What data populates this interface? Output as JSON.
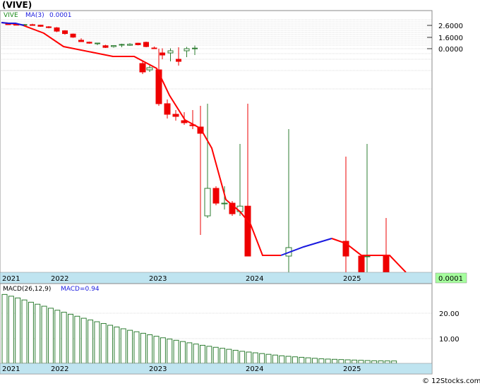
{
  "title": "(VIVE)",
  "watermark": "© 12Stocks.com",
  "colors": {
    "background": "#ffffff",
    "axis_bar": "#bfe4f0",
    "grid": "#bdbdbd",
    "candle_down": "#ee0000",
    "candle_up": "#2e7d32",
    "ma_down": "#ff0000",
    "ma_up": "#1a1adf",
    "macd_bar": "#2e7d32",
    "price_tag_bg": "#a5ff9d",
    "legend_symbol": "#1a8a1a",
    "legend_text": "#1a1adf"
  },
  "chart_data": [
    {
      "type": "candlestick",
      "panel": "price",
      "symbol": "VIVE",
      "legend": {
        "symbol": "VIVE",
        "ma_label": "MA(3)",
        "ma_value": "0.0001"
      },
      "y_ticks": [
        "2.6000",
        "1.6000",
        "0.0000"
      ],
      "last_price_label": "0.0001",
      "x_tick_labels": [
        "2021",
        "2022",
        "2023",
        "2024",
        "2025"
      ],
      "grid": true,
      "price_scale_note": "prices shown on an uneven (log-like) scale; estimated from candle positions",
      "candles": [
        {
          "date": "2021-01",
          "o": 2.72,
          "h": 2.78,
          "l": 2.66,
          "c": 2.68
        },
        {
          "date": "2021-02",
          "o": 2.68,
          "h": 2.74,
          "l": 2.6,
          "c": 2.64
        },
        {
          "date": "2021-03",
          "o": 2.63,
          "h": 2.7,
          "l": 2.58,
          "c": 2.67
        },
        {
          "date": "2021-04",
          "o": 2.66,
          "h": 2.74,
          "l": 2.58,
          "c": 2.62
        },
        {
          "date": "2021-05",
          "o": 2.62,
          "h": 2.66,
          "l": 2.48,
          "c": 2.52
        },
        {
          "date": "2021-06",
          "o": 2.48,
          "h": 2.54,
          "l": 2.36,
          "c": 2.42
        },
        {
          "date": "2021-07",
          "o": 2.4,
          "h": 2.46,
          "l": 2.04,
          "c": 2.12
        },
        {
          "date": "2021-08",
          "o": 2.15,
          "h": 2.2,
          "l": 1.82,
          "c": 1.92
        },
        {
          "date": "2021-09",
          "o": 1.88,
          "h": 1.92,
          "l": 1.54,
          "c": 1.62
        },
        {
          "date": "2021-10",
          "o": 1.2,
          "h": 1.48,
          "l": 0.95,
          "c": 1.0
        },
        {
          "date": "2021-11",
          "o": 0.92,
          "h": 1.0,
          "l": 0.7,
          "c": 0.78
        },
        {
          "date": "2021-12",
          "o": 0.7,
          "h": 0.82,
          "l": 0.5,
          "c": 0.8
        },
        {
          "date": "2022-01",
          "o": 0.42,
          "h": 0.55,
          "l": 0.1,
          "c": 0.18
        },
        {
          "date": "2022-02",
          "o": 0.3,
          "h": 0.5,
          "l": 0.15,
          "c": 0.44
        },
        {
          "date": "2022-03",
          "o": 0.52,
          "h": 0.7,
          "l": 0.2,
          "c": 0.6
        },
        {
          "date": "2022-04",
          "o": 0.48,
          "h": 0.78,
          "l": 0.4,
          "c": 0.62
        },
        {
          "date": "2022-05",
          "o": 0.78,
          "h": 0.84,
          "l": 0.48,
          "c": 0.56
        },
        {
          "date": "2022-06",
          "o": 0.9,
          "h": 1.0,
          "l": 0.2,
          "c": 0.3
        },
        {
          "date": "2022-07",
          "o": 0.1,
          "h": 0.3,
          "l": 0.0,
          "c": 0.05
        },
        {
          "date": "2022-08",
          "o": -0.1,
          "h": 0.05,
          "l": -0.25,
          "c": -0.15
        },
        {
          "date": "2022-09",
          "o": -0.1,
          "h": 0.05,
          "l": -0.3,
          "c": -0.05
        },
        {
          "date": "2022-10",
          "o": -0.25,
          "h": 0.2,
          "l": -0.4,
          "c": -0.3
        },
        {
          "date": "2022-11",
          "o": -0.05,
          "h": 0.25,
          "l": -0.2,
          "c": 0.0
        },
        {
          "date": "2022-12",
          "o": 0.0,
          "h": 0.45,
          "l": -0.15,
          "c": 0.08
        }
      ],
      "note": "Only early candles listed with estimated values; later candles continue the decline toward 0.0001"
    },
    {
      "type": "bar",
      "panel": "macd",
      "legend": {
        "label": "MACD(26,12,9)",
        "value_label": "MACD=0.94"
      },
      "y_ticks": [
        "20.00",
        "10.00"
      ],
      "x_tick_labels": [
        "2021",
        "2022",
        "2023",
        "2024",
        "2025"
      ],
      "grid": true,
      "values": [
        27.5,
        26.8,
        26.1,
        25.3,
        24.4,
        23.6,
        22.8,
        22.0,
        21.2,
        20.4,
        19.6,
        18.8,
        18.0,
        17.3,
        16.6,
        15.9,
        15.2,
        14.5,
        13.8,
        13.2,
        12.6,
        12.0,
        11.4,
        10.8,
        10.2,
        9.7,
        9.2,
        8.7,
        8.2,
        7.7,
        7.2,
        6.8,
        6.4,
        6.0,
        5.6,
        5.2,
        4.8,
        4.5,
        4.2,
        3.9,
        3.6,
        3.3,
        3.0,
        2.8,
        2.6,
        2.4,
        2.2,
        2.0,
        1.8,
        1.7,
        1.6,
        1.5,
        1.4,
        1.3,
        1.2,
        1.1,
        1.0,
        0.98,
        0.96,
        0.94
      ]
    }
  ]
}
